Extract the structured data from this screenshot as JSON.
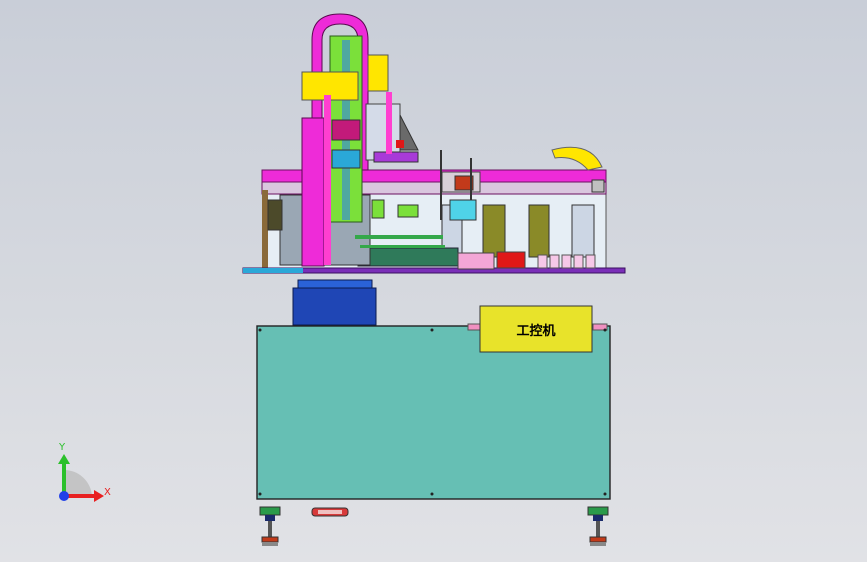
{
  "scene": {
    "background_top": "#c9ced8",
    "background_bottom": "#e1e2e6"
  },
  "machine": {
    "control_panel_label": "工控机",
    "colors": {
      "cabinet": "#66bfb4",
      "label_panel": "#e8e32a",
      "frame_magenta": "#ee2bd8",
      "arm_green": "#7be03a",
      "motor_blue": "#1f46b5",
      "plate_purple": "#7a2fb8",
      "rail_pink": "#ff3fd0",
      "accent_yellow": "#ffe600",
      "accent_red": "#e01818"
    }
  },
  "triad": {
    "y_label": "Y",
    "x_label": "X",
    "y_color": "#2bc02b",
    "x_color": "#e82020",
    "z_color": "#2040e8"
  }
}
